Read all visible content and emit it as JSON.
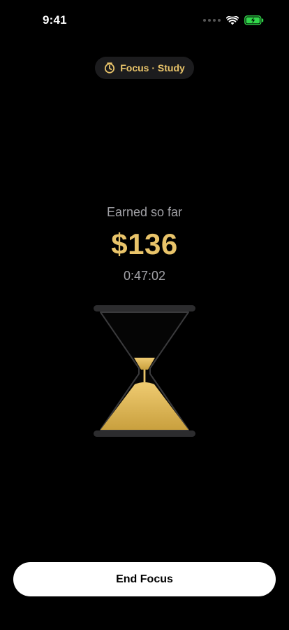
{
  "status_bar": {
    "time": "9:41",
    "battery_color": "#32D74B"
  },
  "focus": {
    "mode_label": "Focus · Study",
    "accent_color": "#E9C46A",
    "icon": "timer-icon"
  },
  "earnings": {
    "label": "Earned so far",
    "amount": "$136",
    "elapsed": "0:47:02"
  },
  "hourglass": {
    "sand_color": "#E9C46A",
    "frame_color": "#2c2c2e"
  },
  "actions": {
    "end_label": "End Focus"
  }
}
